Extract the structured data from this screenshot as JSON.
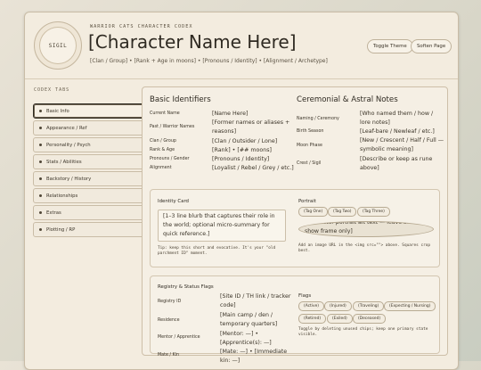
{
  "header": {
    "sigil": "SIGIL",
    "codex_label": "WARRIOR CATS CHARACTER CODEX",
    "name": "[Character Name Here]",
    "subtitle": "[Clan / Group] • [Rank + Age in moons] • [Pronouns / Identity] • [Alignment / Archetype]",
    "toggle_theme": "Toggle Theme",
    "soften_page": "Soften Page"
  },
  "sidebar": {
    "title": "CODEX TABS",
    "items": [
      {
        "label": "Basic Info"
      },
      {
        "label": "Appearance / Ref"
      },
      {
        "label": "Personality / Psych"
      },
      {
        "label": "Stats / Abilities"
      },
      {
        "label": "Backstory / History"
      },
      {
        "label": "Relationships"
      },
      {
        "label": "Extras"
      },
      {
        "label": "Plotting / RP"
      }
    ]
  },
  "basic": {
    "title": "Basic Identifiers",
    "rows": [
      {
        "label": "Current Name",
        "value": "[Name Here]"
      },
      {
        "label": "Past / Warrior Names",
        "value": "[Former names or aliases + reasons]"
      },
      {
        "label": "Clan / Group",
        "value": "[Clan / Outsider / Lone]"
      },
      {
        "label": "Rank & Age",
        "value": "[Rank] • [## moons]"
      },
      {
        "label": "Pronouns / Gender",
        "value": "[Pronouns / Identity]"
      },
      {
        "label": "Alignment",
        "value": "[Loyalist / Rebel / Grey / etc.]"
      }
    ]
  },
  "astral": {
    "title": "Ceremonial & Astral Notes",
    "rows": [
      {
        "label": "Naming / Ceremony",
        "value": "[Who named them / how / lore notes]"
      },
      {
        "label": "Birth Season",
        "value": "[Leaf-bare / Newleaf / etc.]"
      },
      {
        "label": "Moon Phase",
        "value": "[New / Crescent / Half / Full — symbolic meaning]"
      },
      {
        "label": "Crest / Sigil",
        "value": "[Describe or keep as rune above]"
      }
    ]
  },
  "identity": {
    "title": "Identity Card",
    "blurb": "[1–3 line blurb that captures their role in the world; optional micro-summary for quick reference.]",
    "tip": "Tip: keep this short and evocative. It's your \"old parchment ID\" moment."
  },
  "portrait": {
    "title": "Portrait",
    "tags": [
      "(Tag One)",
      "(Tag Two)",
      "(Tag Three)"
    ],
    "alt": "[Character portrait alt text — leave blank to show frame only]",
    "note": "Add an image URL in the <img src=\"\"> above. Squares crop best."
  },
  "registry": {
    "title": "Registry & Status Flags",
    "rows": [
      {
        "label": "Registry ID",
        "value": "[Site ID / TH link / tracker code]"
      },
      {
        "label": "Residence",
        "value": "[Main camp / den / temporary quarters]"
      },
      {
        "label": "Mentor / Apprentice",
        "value": "[Mentor: —] • [Apprentice(s): —]"
      },
      {
        "label": "Mate / Kin",
        "value": "[Mate: —] • [Immediate kin: —]"
      }
    ]
  },
  "flags": {
    "title": "Flags",
    "chips": [
      "(Active)",
      "(Injured)",
      "(Traveling)",
      "(Expecting / Nursing)",
      "(Retired)",
      "(Exiled)",
      "(Deceased)"
    ],
    "note": "Toggle by deleting unused chips; keep one primary state visible."
  }
}
